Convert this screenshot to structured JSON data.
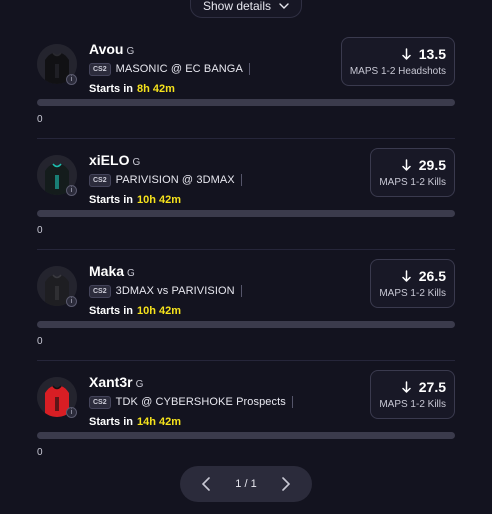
{
  "header": {
    "show_details_label": "Show details"
  },
  "cards": [
    {
      "player": "Avou",
      "position": "G",
      "game": "CS2",
      "match": "MASONIC @ EC BANGA",
      "starts_label": "Starts in",
      "starts_time": "8h 42m",
      "stat_value": "13.5",
      "stat_label": "MAPS 1-2 Headshots",
      "progress": 0,
      "progress_value": "0",
      "jersey_color": "#111114",
      "jersey_trim": "#2a2a30"
    },
    {
      "player": "xiELO",
      "position": "G",
      "game": "CS2",
      "match": "PARIVISION @ 3DMAX",
      "starts_label": "Starts in",
      "starts_time": "10h 42m",
      "stat_value": "29.5",
      "stat_label": "MAPS 1-2 Kills",
      "progress": 0,
      "progress_value": "0",
      "jersey_color": "#141c1c",
      "jersey_trim": "#1dbfb0"
    },
    {
      "player": "Maka",
      "position": "G",
      "game": "CS2",
      "match": "3DMAX vs PARIVISION",
      "starts_label": "Starts in",
      "starts_time": "10h 42m",
      "stat_value": "26.5",
      "stat_label": "MAPS 1-2 Kills",
      "progress": 0,
      "progress_value": "0",
      "jersey_color": "#1e1e22",
      "jersey_trim": "#3a3a40"
    },
    {
      "player": "Xant3r",
      "position": "G",
      "game": "CS2",
      "match": "TDK @ CYBERSHOKE Prospects",
      "starts_label": "Starts in",
      "starts_time": "14h 42m",
      "stat_value": "27.5",
      "stat_label": "MAPS 1-2 Kills",
      "progress": 0,
      "progress_value": "0",
      "jersey_color": "#d81e24",
      "jersey_trim": "#111111"
    }
  ],
  "icons": {
    "stat_direction": "arrow-down-icon",
    "avatar_badge": "info-icon",
    "pager_prev": "chevron-left-icon",
    "pager_next": "chevron-right-icon",
    "show_details": "chevron-down-icon"
  },
  "pagination": {
    "label": "1 / 1"
  }
}
